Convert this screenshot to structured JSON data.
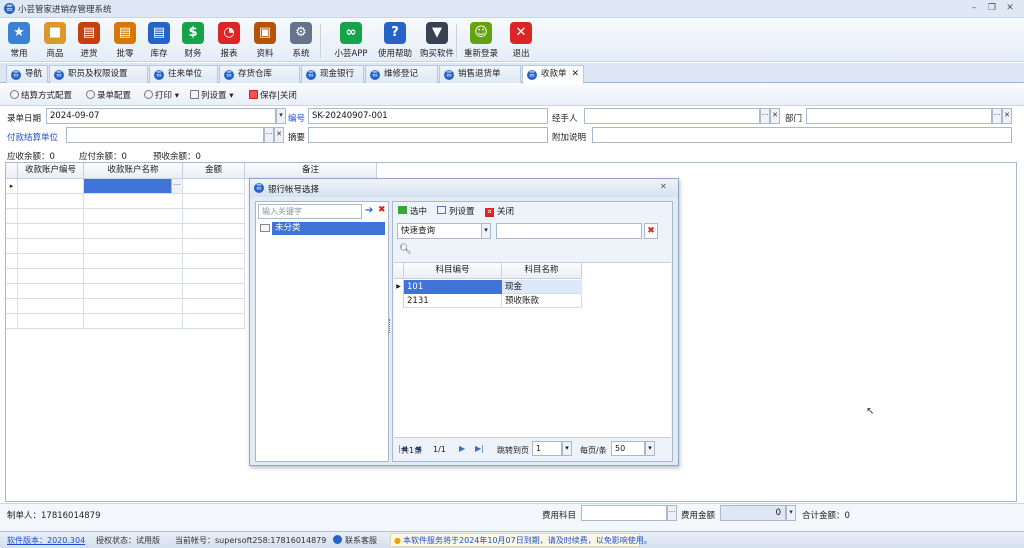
{
  "window": {
    "title": "小芸管家进销存管理系统"
  },
  "toolbar": {
    "items": [
      {
        "label": "常用",
        "icon": "star-icon",
        "color": "#3b82d6",
        "glyph": "★"
      },
      {
        "label": "商品",
        "icon": "box-icon",
        "color": "#d99a2b",
        "glyph": "■"
      },
      {
        "label": "进货",
        "icon": "purchase-icon",
        "color": "#c2410c",
        "glyph": "▤"
      },
      {
        "label": "批零",
        "icon": "wholesale-icon",
        "color": "#d97706",
        "glyph": "▤"
      },
      {
        "label": "库存",
        "icon": "inventory-icon",
        "color": "#2563c9",
        "glyph": "▤"
      },
      {
        "label": "财务",
        "icon": "finance-icon",
        "color": "#16a34a",
        "glyph": "$"
      },
      {
        "label": "报表",
        "icon": "report-icon",
        "color": "#dc2626",
        "glyph": "◔"
      },
      {
        "label": "资料",
        "icon": "data-icon",
        "color": "#b45309",
        "glyph": "▣"
      },
      {
        "label": "系统",
        "icon": "system-icon",
        "color": "#64748b",
        "glyph": "⚙"
      },
      {
        "label": "小芸APP",
        "icon": "app-icon",
        "color": "#16a34a",
        "glyph": "∞"
      },
      {
        "label": "使用帮助",
        "icon": "help-icon",
        "color": "#2563c9",
        "glyph": "?"
      },
      {
        "label": "购买软件",
        "icon": "cart-icon",
        "color": "#374151",
        "glyph": "▼"
      },
      {
        "label": "重新登录",
        "icon": "relogin-icon",
        "color": "#65a30d",
        "glyph": "☺"
      },
      {
        "label": "退出",
        "icon": "exit-icon",
        "color": "#dc2626",
        "glyph": "✕"
      }
    ]
  },
  "tabs": [
    {
      "label": "导航",
      "close": ""
    },
    {
      "label": "职员及权限设置",
      "close": ""
    },
    {
      "label": "往来单位",
      "close": ""
    },
    {
      "label": "存货仓库",
      "close": ""
    },
    {
      "label": "现金银行",
      "close": ""
    },
    {
      "label": "维修登记",
      "close": ""
    },
    {
      "label": "销售退货单",
      "close": ""
    },
    {
      "label": "收款单",
      "close": "✕"
    }
  ],
  "subbar": {
    "settle_config": "结算方式配置",
    "doc_config": "录单配置",
    "print": "打印",
    "columns": "列设置",
    "save_close": "保存|关闭"
  },
  "form": {
    "date_label": "录单日期",
    "date_value": "2024-09-07",
    "no_label": "编号",
    "no_value": "SK-20240907-001",
    "handler_label": "经手人",
    "handler_value": "",
    "dept_label": "部门",
    "dept_value": "",
    "payer_label": "付款结算单位",
    "payer_value": "",
    "summary_label": "摘要",
    "summary_value": "",
    "note_label": "附加说明",
    "note_value": "",
    "receivable": "应收余额：0",
    "payable": "应付余额：0",
    "prereceive": "预收余额：0"
  },
  "grid": {
    "columns": [
      "收款账户编号",
      "收款账户名称",
      "金额",
      "备注"
    ],
    "cell_btn": "···"
  },
  "dialog": {
    "title": "银行帐号选择",
    "keyword_placeholder": "输入关键字",
    "tree_item": "未分类",
    "select_btn": "选中",
    "columns_btn": "列设置",
    "close_btn": "关闭",
    "query_mode": "快速查询",
    "table_headers": [
      "科目编号",
      "科目名称"
    ],
    "rows": [
      [
        "101",
        "现金"
      ],
      [
        "2131",
        "预收账款"
      ]
    ],
    "pager": {
      "page": "1/1",
      "jump_label": "跳转到页",
      "jump_value": "1",
      "per_page_label": "每页/条",
      "per_page_value": "50",
      "total": "共1条"
    }
  },
  "bottom": {
    "maker": "制单人：17816014879",
    "fee_subject": "费用科目",
    "fee_amount": "费用金额",
    "fee_value": "0",
    "total": "合计金额：0"
  },
  "status": {
    "version": "软件版本：2020.304",
    "license": "授权状态：试用版",
    "account": "当前帐号：supersoft258:17816014879",
    "service": "联系客服",
    "notice": "本软件服务将于2024年10月07日到期，请及时续费，以免影响使用。"
  }
}
